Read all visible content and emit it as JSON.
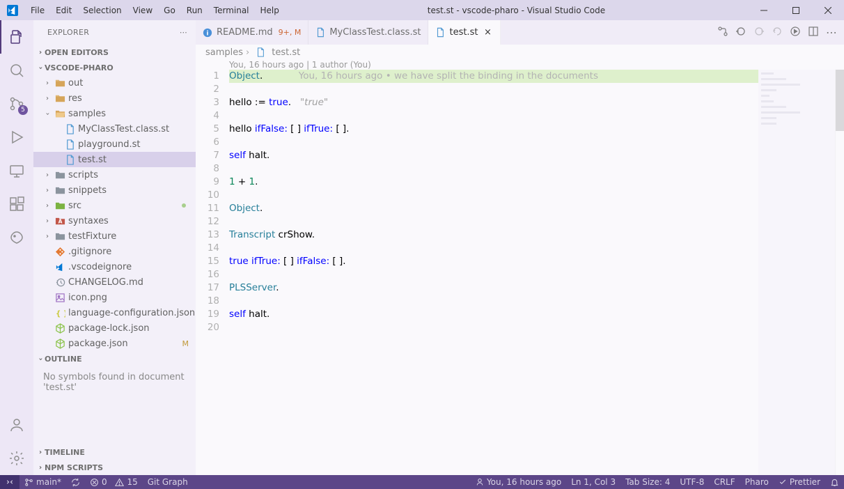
{
  "title": "test.st - vscode-pharo - Visual Studio Code",
  "menu": [
    "File",
    "Edit",
    "Selection",
    "View",
    "Go",
    "Run",
    "Terminal",
    "Help"
  ],
  "activity": {
    "scm_badge": "5"
  },
  "sidebar": {
    "title": "EXPLORER",
    "sections": {
      "open_editors": "OPEN EDITORS",
      "workspace": "VSCODE-PHARO",
      "outline": "OUTLINE",
      "timeline": "TIMELINE",
      "npm": "NPM SCRIPTS"
    },
    "tree": [
      {
        "indent": 1,
        "chev": "r",
        "icon": "folder",
        "name": "out"
      },
      {
        "indent": 1,
        "chev": "r",
        "icon": "folder",
        "name": "res"
      },
      {
        "indent": 1,
        "chev": "d",
        "icon": "folder-open",
        "name": "samples"
      },
      {
        "indent": 2,
        "chev": "",
        "icon": "file-b",
        "name": "MyClassTest.class.st"
      },
      {
        "indent": 2,
        "chev": "",
        "icon": "file-b",
        "name": "playground.st"
      },
      {
        "indent": 2,
        "chev": "",
        "icon": "file-b",
        "name": "test.st",
        "sel": true
      },
      {
        "indent": 1,
        "chev": "r",
        "icon": "folder-g",
        "name": "scripts"
      },
      {
        "indent": 1,
        "chev": "r",
        "icon": "folder-g",
        "name": "snippets"
      },
      {
        "indent": 1,
        "chev": "r",
        "icon": "folder-r",
        "name": "src",
        "dot": true
      },
      {
        "indent": 1,
        "chev": "r",
        "icon": "folder-a",
        "name": "syntaxes"
      },
      {
        "indent": 1,
        "chev": "r",
        "icon": "folder-g",
        "name": "testFixture"
      },
      {
        "indent": 1,
        "chev": "",
        "icon": "git",
        "name": ".gitignore"
      },
      {
        "indent": 1,
        "chev": "",
        "icon": "vs",
        "name": ".vscodeignore"
      },
      {
        "indent": 1,
        "chev": "",
        "icon": "hist",
        "name": "CHANGELOG.md"
      },
      {
        "indent": 1,
        "chev": "",
        "icon": "img",
        "name": "icon.png"
      },
      {
        "indent": 1,
        "chev": "",
        "icon": "json-y",
        "name": "language-configuration.json"
      },
      {
        "indent": 1,
        "chev": "",
        "icon": "npm",
        "name": "package-lock.json"
      },
      {
        "indent": 1,
        "chev": "",
        "icon": "npm",
        "name": "package.json",
        "mod": "M"
      }
    ],
    "outline_msg": "No symbols found in document 'test.st'"
  },
  "tabs": [
    {
      "icon": "info",
      "label": "README.md",
      "meta": "9+, M",
      "active": false,
      "close": false
    },
    {
      "icon": "file-b",
      "label": "MyClassTest.class.st",
      "meta": "",
      "active": false,
      "close": false
    },
    {
      "icon": "file-b",
      "label": "test.st",
      "meta": "",
      "active": true,
      "close": true
    }
  ],
  "breadcrumb": {
    "a": "samples",
    "b": "test.st"
  },
  "blame_top": "You, 16 hours ago | 1 author (You)",
  "inline_blame": "You, 16 hours ago • we have split the binding in the documents",
  "code": {
    "lines": [
      {
        "n": 1,
        "html": "<span class='tkn-cls'>Object</span>.",
        "hl": true,
        "blame": true
      },
      {
        "n": 2,
        "html": ""
      },
      {
        "n": 3,
        "html": "hello := <span class='tkn-kw'>true</span>.   <span class='tkn-str'>\"true\"</span>"
      },
      {
        "n": 4,
        "html": ""
      },
      {
        "n": 5,
        "html": "hello <span class='tkn-msg'>ifFalse:</span> [ ] <span class='tkn-msg'>ifTrue:</span> [ ]."
      },
      {
        "n": 6,
        "html": ""
      },
      {
        "n": 7,
        "html": "<span class='tkn-kw'>self</span> halt."
      },
      {
        "n": 8,
        "html": ""
      },
      {
        "n": 9,
        "html": "<span class='tkn-num'>1</span> + <span class='tkn-num'>1</span>."
      },
      {
        "n": 10,
        "html": ""
      },
      {
        "n": 11,
        "html": "<span class='tkn-cls'>Object</span>."
      },
      {
        "n": 12,
        "html": ""
      },
      {
        "n": 13,
        "html": "<span class='tkn-cls'>Transcript</span> crShow."
      },
      {
        "n": 14,
        "html": ""
      },
      {
        "n": 15,
        "html": "<span class='tkn-kw'>true</span> <span class='tkn-msg'>ifTrue:</span> [ ] <span class='tkn-msg'>ifFalse:</span> [ ]."
      },
      {
        "n": 16,
        "html": ""
      },
      {
        "n": 17,
        "html": "<span class='tkn-cls'>PLSServer</span>."
      },
      {
        "n": 18,
        "html": ""
      },
      {
        "n": 19,
        "html": "<span class='tkn-kw'>self</span> halt."
      },
      {
        "n": 20,
        "html": ""
      }
    ]
  },
  "status": {
    "branch": "main*",
    "errors": "0",
    "warnings": "15",
    "gitgraph": "Git Graph",
    "blame": "You, 16 hours ago",
    "pos": "Ln 1, Col 3",
    "tab": "Tab Size: 4",
    "enc": "UTF-8",
    "eol": "CRLF",
    "lang": "Pharo",
    "fmt": "Prettier"
  }
}
